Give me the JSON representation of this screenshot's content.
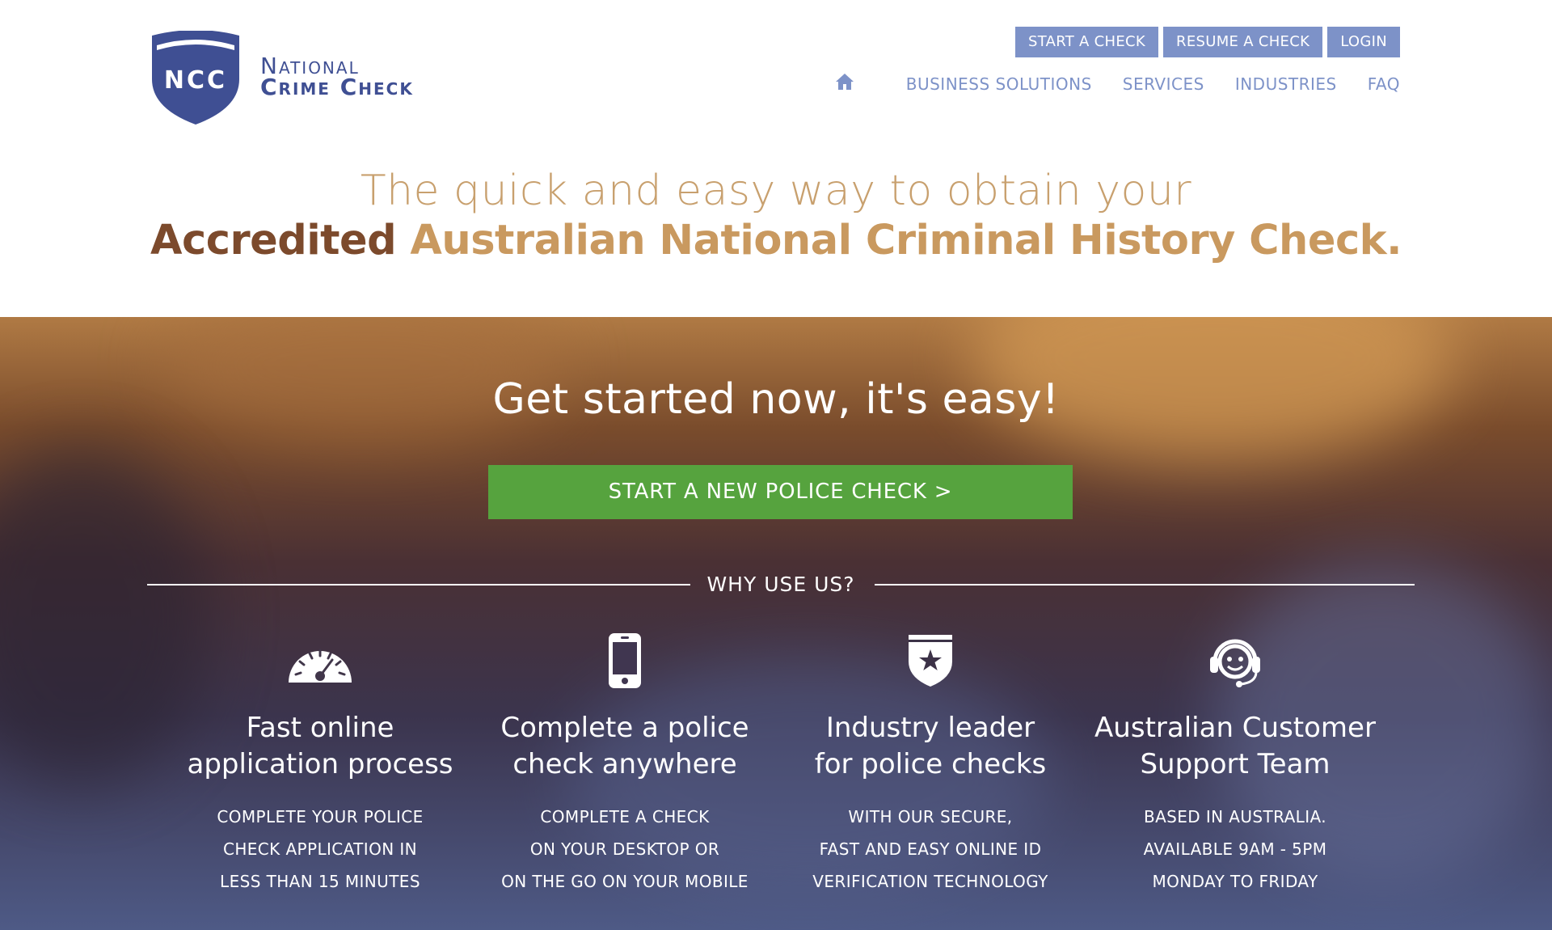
{
  "brand": {
    "logo_initials": "NCC",
    "name_line1": "National",
    "name_line2": "Crime Check",
    "primary_color": "#3f4f93",
    "accent_color": "#7d92c8"
  },
  "top_buttons": [
    {
      "label": "START A CHECK"
    },
    {
      "label": "RESUME A CHECK"
    },
    {
      "label": "LOGIN"
    }
  ],
  "nav": {
    "home_icon": "home-icon",
    "items": [
      {
        "label": "BUSINESS SOLUTIONS"
      },
      {
        "label": "SERVICES"
      },
      {
        "label": "INDUSTRIES"
      },
      {
        "label": "FAQ"
      }
    ]
  },
  "headline": {
    "line1": "The quick and easy way to obtain your",
    "line2_dark": "Accredited",
    "line2_gold": " Australian National Criminal History Check."
  },
  "hero": {
    "title": "Get started now, it's easy!",
    "cta_label": "START A NEW POLICE CHECK >",
    "cta_color": "#56a33e",
    "section_label": "WHY USE US?"
  },
  "features": [
    {
      "icon": "speedometer-icon",
      "title_line1": "Fast online",
      "title_line2": "application process",
      "desc_line1": "COMPLETE YOUR POLICE",
      "desc_line2": "CHECK APPLICATION IN",
      "desc_line3": "LESS THAN 15 MINUTES"
    },
    {
      "icon": "mobile-phone-icon",
      "title_line1": "Complete a police",
      "title_line2": "check anywhere",
      "desc_line1": "COMPLETE A CHECK",
      "desc_line2": "ON YOUR DESKTOP OR",
      "desc_line3": "ON THE GO ON YOUR MOBILE"
    },
    {
      "icon": "shield-star-icon",
      "title_line1": "Industry leader",
      "title_line2": "for police checks",
      "desc_line1": "WITH OUR SECURE,",
      "desc_line2": "FAST AND EASY ONLINE ID",
      "desc_line3": "VERIFICATION TECHNOLOGY"
    },
    {
      "icon": "headset-support-icon",
      "title_line1": "Australian Customer",
      "title_line2": "Support Team",
      "desc_line1": "BASED IN AUSTRALIA.",
      "desc_line2": "AVAILABLE 9AM - 5PM",
      "desc_line3": "MONDAY TO FRIDAY"
    }
  ]
}
